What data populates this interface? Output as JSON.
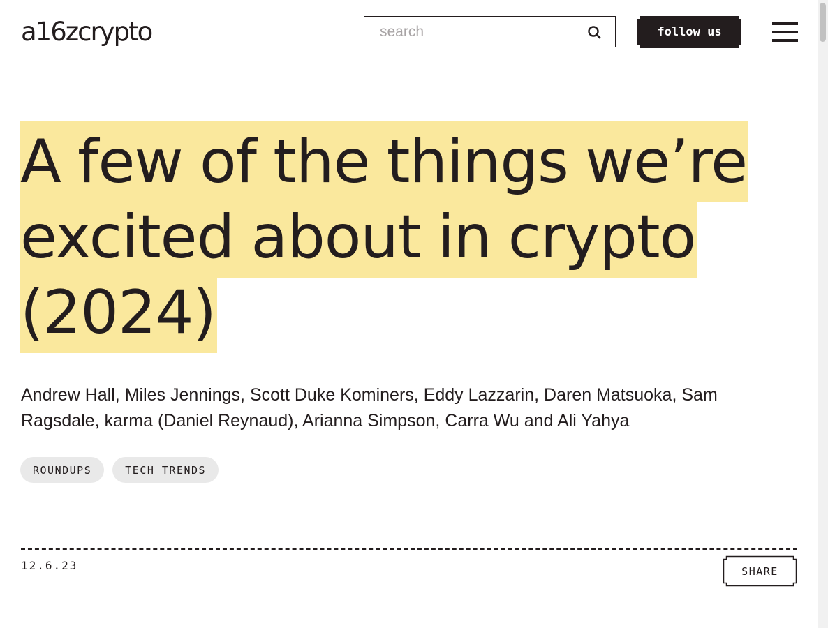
{
  "header": {
    "logo": "a16zcrypto",
    "search_placeholder": "search",
    "follow_label": "follow us"
  },
  "article": {
    "title_lines": [
      "A few of the things we’re",
      "excited about in crypto",
      "(2024)"
    ],
    "authors": [
      {
        "name": "Andrew Hall",
        "sep": ", "
      },
      {
        "name": "Miles Jennings",
        "sep": ", "
      },
      {
        "name": "Scott Duke Kominers",
        "sep": ", "
      },
      {
        "name": "Eddy Lazzarin",
        "sep": ", "
      },
      {
        "name": "Daren Matsuoka",
        "sep": ", "
      },
      {
        "name": "Sam Ragsdale",
        "sep": ", "
      },
      {
        "name": "karma (Daniel Reynaud)",
        "sep": ", "
      },
      {
        "name": "Arianna Simpson",
        "sep": ", "
      },
      {
        "name": "Carra Wu",
        "sep": " and "
      },
      {
        "name": "Ali Yahya",
        "sep": ""
      }
    ],
    "tags": [
      "ROUNDUPS",
      "TECH TRENDS"
    ],
    "date": "12.6.23",
    "share_label": "SHARE"
  },
  "colors": {
    "ink": "#231d1e",
    "highlight": "#fae89d",
    "tag_bg": "#e9e9e9"
  },
  "icons": {
    "search": "search-icon",
    "menu": "hamburger-menu-icon"
  }
}
